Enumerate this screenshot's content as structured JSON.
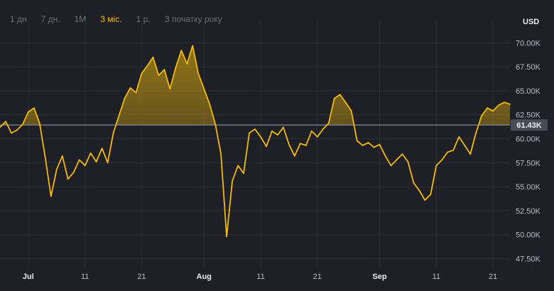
{
  "ranges": [
    {
      "label": "1 дн"
    },
    {
      "label": "7 дн."
    },
    {
      "label": "1M"
    },
    {
      "label": "3 міс."
    },
    {
      "label": "1 р."
    },
    {
      "label": "З початку року"
    }
  ],
  "active_range": 3,
  "colors": {
    "background": "#1e2026",
    "line": "#f0b90b",
    "grid": "#2b2f36",
    "active": "#f0b90b",
    "baseline": "#848e9c"
  },
  "chart_data": {
    "type": "area",
    "unit_label": "USD",
    "x_start": "2024-06-26",
    "x_end": "2024-09-24",
    "ylim": [
      46500,
      71500
    ],
    "y_ticks": [
      47500,
      50000,
      52500,
      55000,
      57500,
      60000,
      62500,
      65000,
      67500,
      70000
    ],
    "y_tick_labels": [
      "47.50K",
      "50.00K",
      "52.50K",
      "55.00K",
      "57.50K",
      "60.00K",
      "62.50K",
      "65.00K",
      "67.50K",
      "70.00K"
    ],
    "x_ticks": [
      {
        "date": "2024-07-01",
        "label": "Jul",
        "bold": true
      },
      {
        "date": "2024-07-11",
        "label": "11",
        "bold": false
      },
      {
        "date": "2024-07-21",
        "label": "21",
        "bold": false
      },
      {
        "date": "2024-08-01",
        "label": "Aug",
        "bold": true
      },
      {
        "date": "2024-08-11",
        "label": "11",
        "bold": false
      },
      {
        "date": "2024-08-21",
        "label": "21",
        "bold": false
      },
      {
        "date": "2024-09-01",
        "label": "Sep",
        "bold": true
      },
      {
        "date": "2024-09-11",
        "label": "11",
        "bold": false
      },
      {
        "date": "2024-09-21",
        "label": "21",
        "bold": false
      }
    ],
    "baseline": {
      "value": 61430,
      "label": "61.43K"
    },
    "grid": true,
    "series": [
      {
        "points": [
          [
            "2024-06-26",
            61200
          ],
          [
            "2024-06-27",
            61800
          ],
          [
            "2024-06-28",
            60600
          ],
          [
            "2024-06-29",
            60900
          ],
          [
            "2024-06-30",
            61500
          ],
          [
            "2024-07-01",
            62800
          ],
          [
            "2024-07-02",
            63200
          ],
          [
            "2024-07-03",
            61600
          ],
          [
            "2024-07-04",
            58000
          ],
          [
            "2024-07-05",
            54000
          ],
          [
            "2024-07-06",
            56800
          ],
          [
            "2024-07-07",
            58200
          ],
          [
            "2024-07-08",
            55800
          ],
          [
            "2024-07-09",
            56500
          ],
          [
            "2024-07-10",
            57800
          ],
          [
            "2024-07-11",
            57200
          ],
          [
            "2024-07-12",
            58500
          ],
          [
            "2024-07-13",
            57600
          ],
          [
            "2024-07-14",
            59000
          ],
          [
            "2024-07-15",
            57500
          ],
          [
            "2024-07-16",
            60600
          ],
          [
            "2024-07-17",
            62400
          ],
          [
            "2024-07-18",
            64200
          ],
          [
            "2024-07-19",
            65300
          ],
          [
            "2024-07-20",
            64800
          ],
          [
            "2024-07-21",
            66800
          ],
          [
            "2024-07-22",
            67600
          ],
          [
            "2024-07-23",
            68500
          ],
          [
            "2024-07-24",
            66600
          ],
          [
            "2024-07-25",
            67200
          ],
          [
            "2024-07-26",
            65200
          ],
          [
            "2024-07-27",
            67400
          ],
          [
            "2024-07-28",
            69200
          ],
          [
            "2024-07-29",
            67800
          ],
          [
            "2024-07-30",
            69700
          ],
          [
            "2024-07-31",
            66800
          ],
          [
            "2024-08-01",
            65200
          ],
          [
            "2024-08-02",
            63600
          ],
          [
            "2024-08-03",
            61500
          ],
          [
            "2024-08-04",
            58400
          ],
          [
            "2024-08-05",
            49800
          ],
          [
            "2024-08-06",
            55600
          ],
          [
            "2024-08-07",
            57200
          ],
          [
            "2024-08-08",
            56400
          ],
          [
            "2024-08-09",
            60600
          ],
          [
            "2024-08-10",
            61000
          ],
          [
            "2024-08-11",
            60200
          ],
          [
            "2024-08-12",
            59200
          ],
          [
            "2024-08-13",
            60800
          ],
          [
            "2024-08-14",
            60400
          ],
          [
            "2024-08-15",
            61200
          ],
          [
            "2024-08-16",
            59400
          ],
          [
            "2024-08-17",
            58200
          ],
          [
            "2024-08-18",
            59500
          ],
          [
            "2024-08-19",
            59300
          ],
          [
            "2024-08-20",
            60800
          ],
          [
            "2024-08-21",
            60200
          ],
          [
            "2024-08-22",
            61000
          ],
          [
            "2024-08-23",
            61600
          ],
          [
            "2024-08-24",
            64200
          ],
          [
            "2024-08-25",
            64600
          ],
          [
            "2024-08-26",
            63800
          ],
          [
            "2024-08-27",
            62900
          ],
          [
            "2024-08-28",
            59800
          ],
          [
            "2024-08-29",
            59300
          ],
          [
            "2024-08-30",
            59600
          ],
          [
            "2024-08-31",
            59100
          ],
          [
            "2024-09-01",
            59400
          ],
          [
            "2024-09-02",
            58200
          ],
          [
            "2024-09-03",
            57200
          ],
          [
            "2024-09-04",
            57800
          ],
          [
            "2024-09-05",
            58400
          ],
          [
            "2024-09-06",
            57600
          ],
          [
            "2024-09-07",
            55400
          ],
          [
            "2024-09-08",
            54600
          ],
          [
            "2024-09-09",
            53600
          ],
          [
            "2024-09-10",
            54200
          ],
          [
            "2024-09-11",
            57200
          ],
          [
            "2024-09-12",
            57800
          ],
          [
            "2024-09-13",
            58600
          ],
          [
            "2024-09-14",
            58800
          ],
          [
            "2024-09-15",
            60200
          ],
          [
            "2024-09-16",
            59300
          ],
          [
            "2024-09-17",
            58400
          ],
          [
            "2024-09-18",
            60600
          ],
          [
            "2024-09-19",
            62400
          ],
          [
            "2024-09-20",
            63200
          ],
          [
            "2024-09-21",
            62900
          ],
          [
            "2024-09-22",
            63500
          ],
          [
            "2024-09-23",
            63800
          ],
          [
            "2024-09-24",
            63600
          ]
        ]
      }
    ]
  }
}
